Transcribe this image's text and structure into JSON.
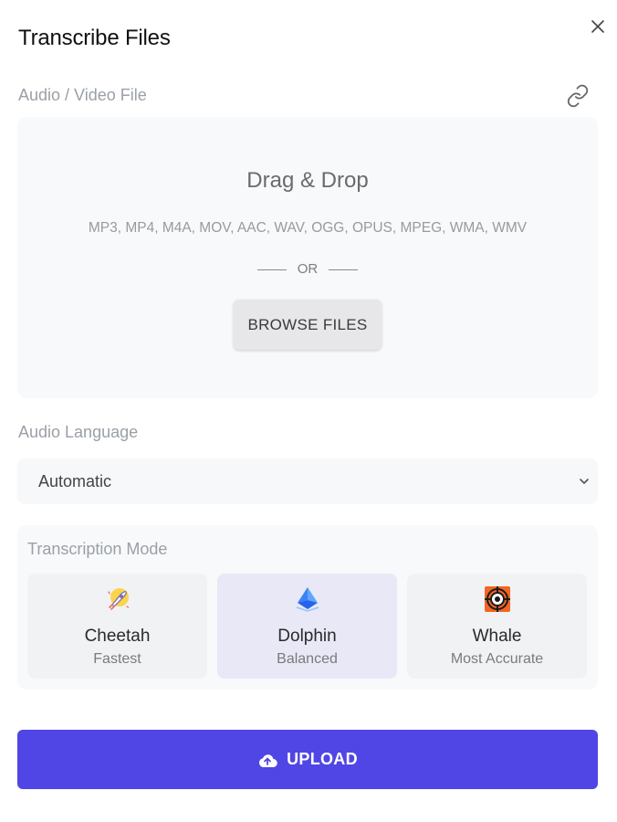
{
  "dialog": {
    "title": "Transcribe Files"
  },
  "file": {
    "label": "Audio / Video File",
    "drag_title": "Drag & Drop",
    "formats": "MP3, MP4, M4A, MOV, AAC, WAV, OGG, OPUS, MPEG, WMA, WMV",
    "or_text": "OR",
    "browse_label": "BROWSE FILES"
  },
  "language": {
    "label": "Audio Language",
    "selected": "Automatic"
  },
  "mode": {
    "label": "Transcription Mode",
    "options": [
      {
        "name": "Cheetah",
        "desc": "Fastest",
        "icon": "rocket-icon",
        "selected": false
      },
      {
        "name": "Dolphin",
        "desc": "Balanced",
        "icon": "pyramid-icon",
        "selected": true
      },
      {
        "name": "Whale",
        "desc": "Most Accurate",
        "icon": "target-icon",
        "selected": false
      }
    ]
  },
  "upload": {
    "label": "UPLOAD",
    "icon": "cloud-upload-icon"
  },
  "colors": {
    "accent": "#4f46e5",
    "selected_card": "#e8e8f6"
  }
}
